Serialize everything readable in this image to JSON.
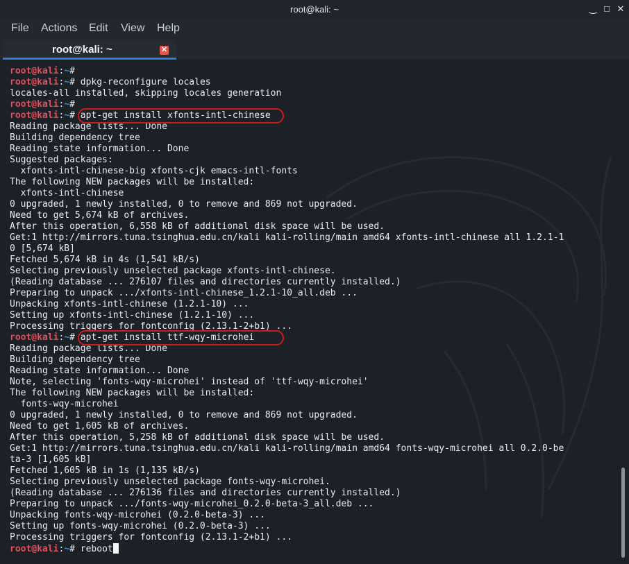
{
  "window": {
    "title": "root@kali: ~",
    "controls": {
      "minimize": "‿",
      "maximize": "□",
      "close": "✕"
    }
  },
  "menu": {
    "items": [
      "File",
      "Actions",
      "Edit",
      "View",
      "Help"
    ]
  },
  "tab": {
    "label": "root@kali: ~",
    "close_icon": "✕"
  },
  "prompt": {
    "user": "root@kali",
    "sep": ":",
    "path": "~",
    "symbol": "# "
  },
  "terminal": {
    "lines": [
      {
        "prompt": true,
        "cmd": ""
      },
      {
        "prompt": true,
        "cmd": "dpkg-reconfigure locales"
      },
      {
        "prompt": false,
        "text": "locales-all installed, skipping locales generation"
      },
      {
        "prompt": true,
        "cmd": ""
      },
      {
        "prompt": true,
        "cmd": "apt-get install xfonts-intl-chinese",
        "highlight": true
      },
      {
        "prompt": false,
        "text": "Reading package lists... Done"
      },
      {
        "prompt": false,
        "text": "Building dependency tree"
      },
      {
        "prompt": false,
        "text": "Reading state information... Done"
      },
      {
        "prompt": false,
        "text": "Suggested packages:"
      },
      {
        "prompt": false,
        "text": "  xfonts-intl-chinese-big xfonts-cjk emacs-intl-fonts"
      },
      {
        "prompt": false,
        "text": "The following NEW packages will be installed:"
      },
      {
        "prompt": false,
        "text": "  xfonts-intl-chinese"
      },
      {
        "prompt": false,
        "text": "0 upgraded, 1 newly installed, 0 to remove and 869 not upgraded."
      },
      {
        "prompt": false,
        "text": "Need to get 5,674 kB of archives."
      },
      {
        "prompt": false,
        "text": "After this operation, 6,558 kB of additional disk space will be used."
      },
      {
        "prompt": false,
        "text": "Get:1 http://mirrors.tuna.tsinghua.edu.cn/kali kali-rolling/main amd64 xfonts-intl-chinese all 1.2.1-1"
      },
      {
        "prompt": false,
        "text": "0 [5,674 kB]"
      },
      {
        "prompt": false,
        "text": "Fetched 5,674 kB in 4s (1,541 kB/s)"
      },
      {
        "prompt": false,
        "text": "Selecting previously unselected package xfonts-intl-chinese."
      },
      {
        "prompt": false,
        "text": "(Reading database ... 276107 files and directories currently installed.)"
      },
      {
        "prompt": false,
        "text": "Preparing to unpack .../xfonts-intl-chinese_1.2.1-10_all.deb ..."
      },
      {
        "prompt": false,
        "text": "Unpacking xfonts-intl-chinese (1.2.1-10) ..."
      },
      {
        "prompt": false,
        "text": "Setting up xfonts-intl-chinese (1.2.1-10) ..."
      },
      {
        "prompt": false,
        "text": "Processing triggers for fontconfig (2.13.1-2+b1) ..."
      },
      {
        "prompt": true,
        "cmd": "apt-get install ttf-wqy-microhei",
        "highlight": true
      },
      {
        "prompt": false,
        "text": "Reading package lists... Done"
      },
      {
        "prompt": false,
        "text": "Building dependency tree"
      },
      {
        "prompt": false,
        "text": "Reading state information... Done"
      },
      {
        "prompt": false,
        "text": "Note, selecting 'fonts-wqy-microhei' instead of 'ttf-wqy-microhei'"
      },
      {
        "prompt": false,
        "text": "The following NEW packages will be installed:"
      },
      {
        "prompt": false,
        "text": "  fonts-wqy-microhei"
      },
      {
        "prompt": false,
        "text": "0 upgraded, 1 newly installed, 0 to remove and 869 not upgraded."
      },
      {
        "prompt": false,
        "text": "Need to get 1,605 kB of archives."
      },
      {
        "prompt": false,
        "text": "After this operation, 5,258 kB of additional disk space will be used."
      },
      {
        "prompt": false,
        "text": "Get:1 http://mirrors.tuna.tsinghua.edu.cn/kali kali-rolling/main amd64 fonts-wqy-microhei all 0.2.0-be"
      },
      {
        "prompt": false,
        "text": "ta-3 [1,605 kB]"
      },
      {
        "prompt": false,
        "text": "Fetched 1,605 kB in 1s (1,135 kB/s)"
      },
      {
        "prompt": false,
        "text": "Selecting previously unselected package fonts-wqy-microhei."
      },
      {
        "prompt": false,
        "text": "(Reading database ... 276136 files and directories currently installed.)"
      },
      {
        "prompt": false,
        "text": "Preparing to unpack .../fonts-wqy-microhei_0.2.0-beta-3_all.deb ..."
      },
      {
        "prompt": false,
        "text": "Unpacking fonts-wqy-microhei (0.2.0-beta-3) ..."
      },
      {
        "prompt": false,
        "text": "Setting up fonts-wqy-microhei (0.2.0-beta-3) ..."
      },
      {
        "prompt": false,
        "text": "Processing triggers for fontconfig (2.13.1-2+b1) ..."
      },
      {
        "prompt": true,
        "cmd": "reboot",
        "cursor": true
      }
    ]
  },
  "colors": {
    "prompt_user": "#e0505a",
    "prompt_path": "#3c8ce0",
    "highlight_ring": "#c81e1e",
    "tab_accent": "#2d7fd4"
  }
}
